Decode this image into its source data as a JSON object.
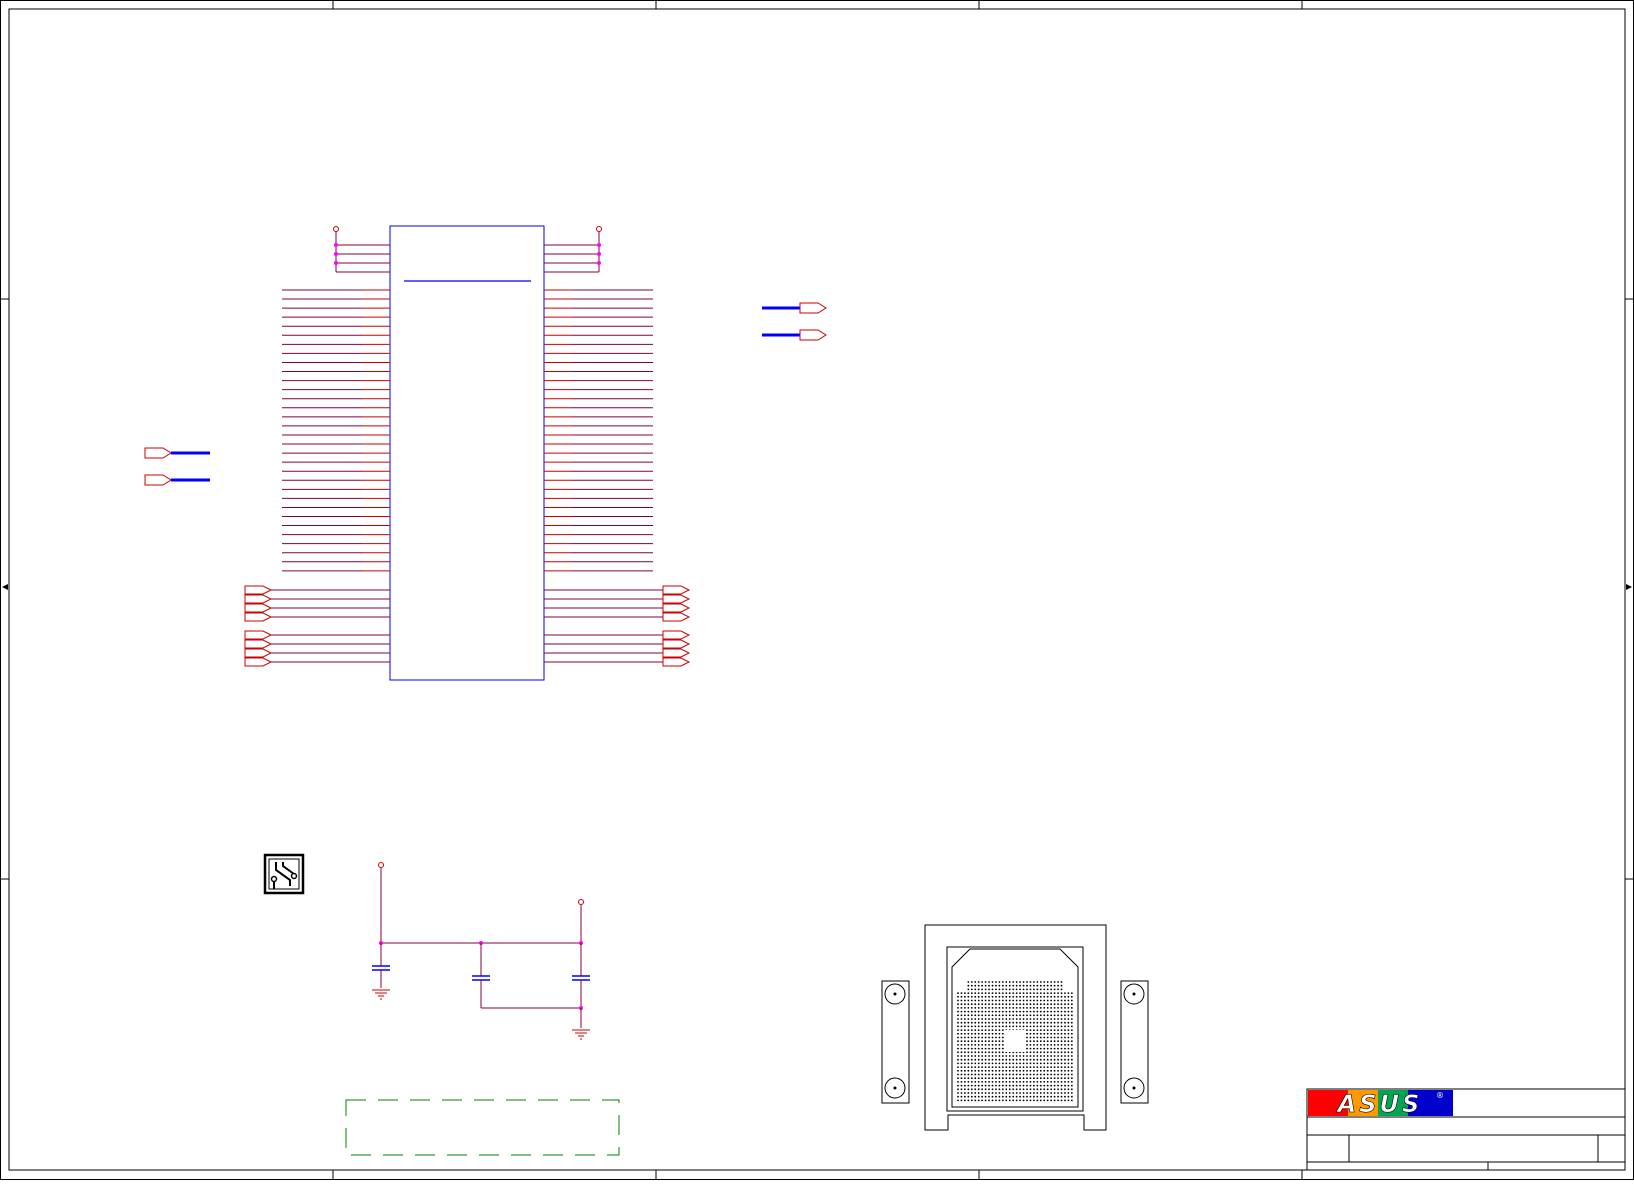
{
  "logo": {
    "text": "ASUS",
    "registered": "®"
  },
  "colors": {
    "border": "#000000",
    "ic_body": "#0000ff",
    "pin_wire": "#cc0000",
    "net_wire": "#800040",
    "junction": "#ff00ff",
    "bus": "#0000ff",
    "ground": "#cc0000",
    "note_box": "#008000",
    "logo_red": "#ff0000",
    "logo_orange": "#ff9900",
    "logo_green": "#00a651",
    "logo_blue": "#0000cc"
  },
  "icons": {
    "pcb": "pcb-trace-icon",
    "socket": "cpu-socket-drawing",
    "offpage": "offpage-connector-icon",
    "power": "power-port-icon",
    "ground": "ground-symbol-icon",
    "capacitor": "capacitor-icon"
  }
}
